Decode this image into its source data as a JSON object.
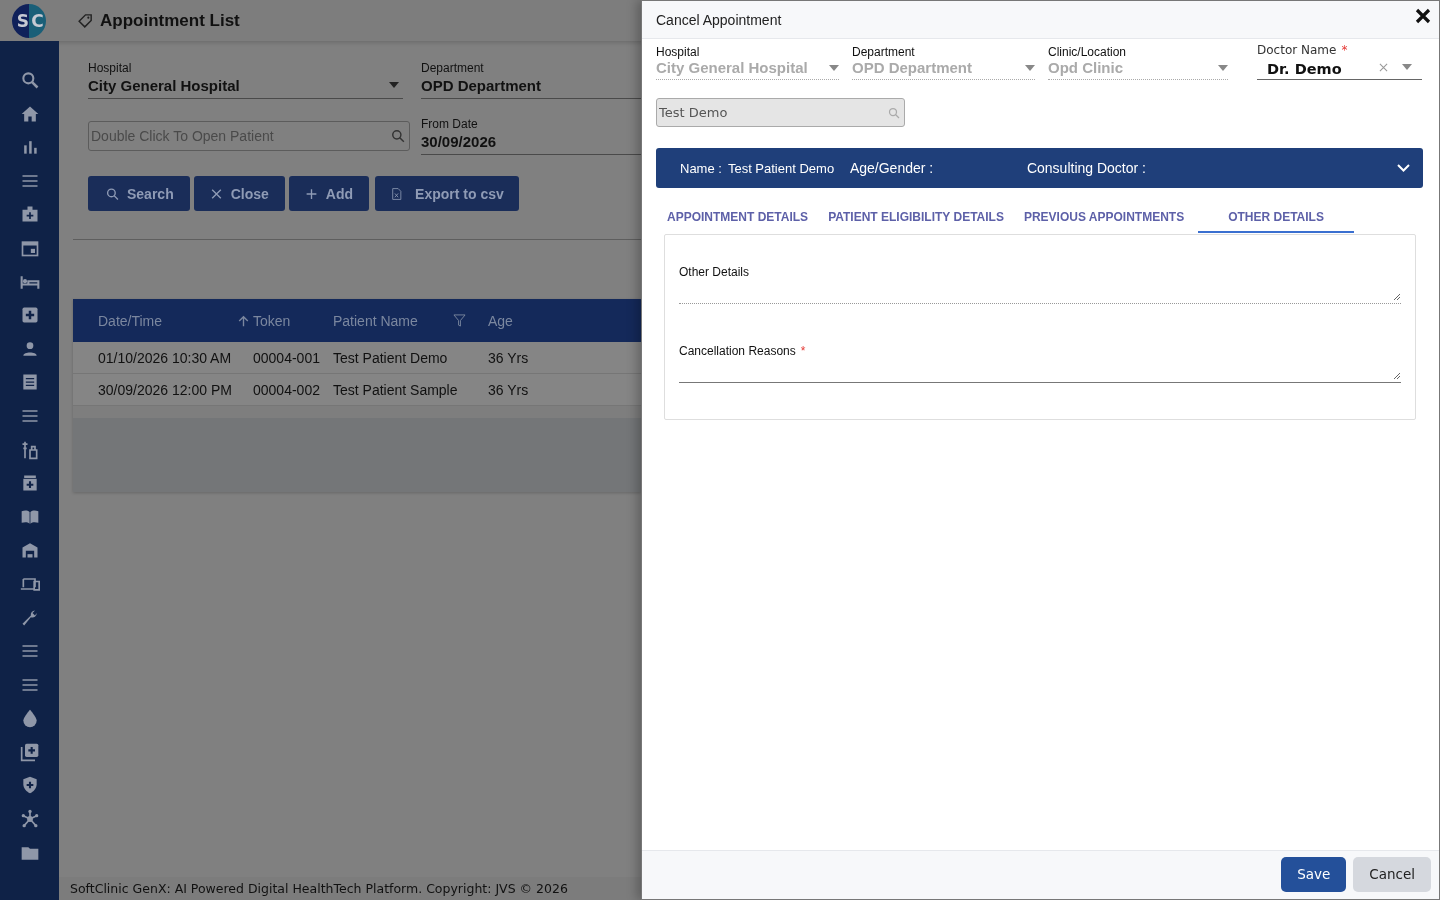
{
  "app": {
    "logo": [
      "S",
      "C"
    ]
  },
  "page": {
    "title": "Appointment List"
  },
  "filters": {
    "hospital": {
      "label": "Hospital",
      "value": "City General Hospital"
    },
    "department": {
      "label": "Department",
      "value": "OPD Department"
    },
    "patient_search": {
      "placeholder": "Double Click To Open Patient"
    },
    "from_date": {
      "label": "From Date",
      "value": "30/09/2026"
    }
  },
  "actions": [
    {
      "kind": "search",
      "label": "Search"
    },
    {
      "kind": "close",
      "label": "Close"
    },
    {
      "kind": "add",
      "label": "Add"
    },
    {
      "kind": "export",
      "label": "Export to csv"
    }
  ],
  "table": {
    "columns": [
      {
        "label": "Date/Time",
        "kind": "sort"
      },
      {
        "label": "Token",
        "kind": "plain"
      },
      {
        "label": "Patient Name",
        "kind": "filter"
      },
      {
        "label": "Age",
        "kind": "plain"
      }
    ],
    "rows": [
      [
        "01/10/2026 10:30 AM",
        "00004-001",
        "Test Patient Demo",
        "36 Yrs"
      ],
      [
        "30/09/2026 12:00 PM",
        "00004-002",
        "Test Patient Sample",
        "36 Yrs"
      ]
    ]
  },
  "status_bar": "SoftClinic GenX: AI Powered Digital HealthTech Platform. Copyright: JVS © 2026",
  "dialog": {
    "title": "Cancel Appointment",
    "fields": [
      {
        "label": "Hospital",
        "value": "City General Hospital",
        "disabled": true
      },
      {
        "label": "Department",
        "value": "OPD Department",
        "disabled": true
      },
      {
        "label": "Clinic/Location",
        "value": "Opd Clinic",
        "disabled": true
      },
      {
        "label": "Doctor Name",
        "value": "Dr. Demo",
        "disabled": false,
        "marker": "*"
      }
    ],
    "patient_search": {
      "value": "Test Demo"
    },
    "patient_bar": {
      "name_label": "Name :",
      "name": "Test Patient Demo",
      "age_label": "Age/Gender :",
      "doctor_label": "Consulting Doctor :"
    },
    "tabs": [
      {
        "label": "APPOINTMENT DETAILS",
        "selected": false
      },
      {
        "label": "PATIENT ELIGIBILITY DETAILS",
        "selected": false
      },
      {
        "label": "PREVIOUS APPOINTMENTS",
        "selected": false
      },
      {
        "label": "OTHER DETAILS",
        "selected": true
      }
    ],
    "textareas": [
      {
        "label": "Other Details"
      },
      {
        "label": "Cancellation Reasons",
        "marker": "*"
      }
    ],
    "buttons": [
      {
        "kind": "primary",
        "label": "Save"
      },
      {
        "kind": "secondary",
        "label": "Cancel"
      }
    ]
  }
}
